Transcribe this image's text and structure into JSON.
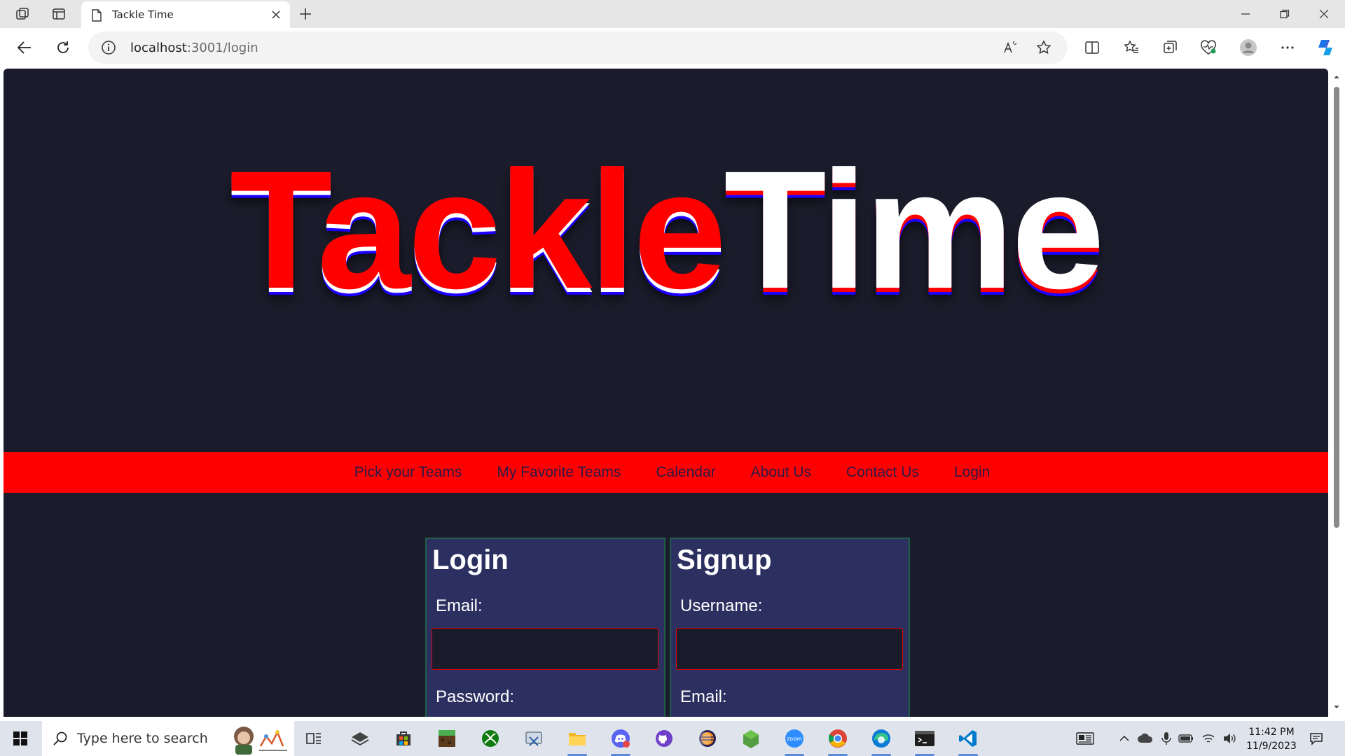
{
  "browser": {
    "tab": {
      "title": "Tackle Time"
    },
    "address": {
      "host": "localhost",
      "path": ":3001/login"
    }
  },
  "page": {
    "logo": {
      "part1": "Tackle",
      "part2": "Time"
    },
    "nav": [
      "Pick your Teams",
      "My Favorite Teams",
      "Calendar",
      "About Us",
      "Contact Us",
      "Login"
    ],
    "login": {
      "title": "Login",
      "email_label": "Email:",
      "password_label": "Password:"
    },
    "signup": {
      "title": "Signup",
      "username_label": "Username:",
      "email_label": "Email:"
    },
    "colors": {
      "background": "#1b1c2b",
      "accent": "#ff0000",
      "card": "#2c3060"
    }
  },
  "taskbar": {
    "search_placeholder": "Type here to search",
    "time": "11:42 PM",
    "date": "11/9/2023"
  }
}
